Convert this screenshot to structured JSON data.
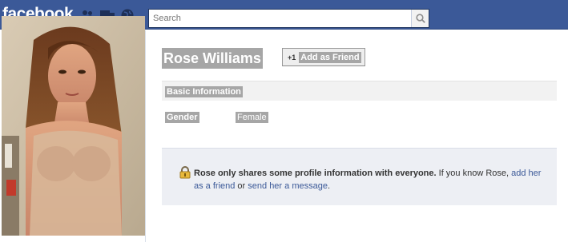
{
  "header": {
    "logo": "facebook",
    "search_placeholder": "Search"
  },
  "profile": {
    "name": "Rose Williams",
    "add_friend_plus": "+1",
    "add_friend_label": "Add as Friend"
  },
  "basic_info": {
    "title": "Basic Information",
    "rows": [
      {
        "label": "Gender",
        "value": "Female"
      }
    ]
  },
  "privacy": {
    "bold_text": "Rose only shares some profile information with everyone.",
    "text_1": " If you know Rose, ",
    "link_add": "add her as a friend",
    "text_2": " or ",
    "link_message": "send her a message",
    "text_3": "."
  },
  "colors": {
    "header_blue": "#3b5998",
    "link_blue": "#3b5998",
    "privacy_bg": "#edeff4",
    "redaction_gray": "#a6a6a6"
  },
  "icons": [
    "friends-icon",
    "messages-icon",
    "globe-icon",
    "search-icon",
    "lock-icon",
    "profile-photo"
  ]
}
